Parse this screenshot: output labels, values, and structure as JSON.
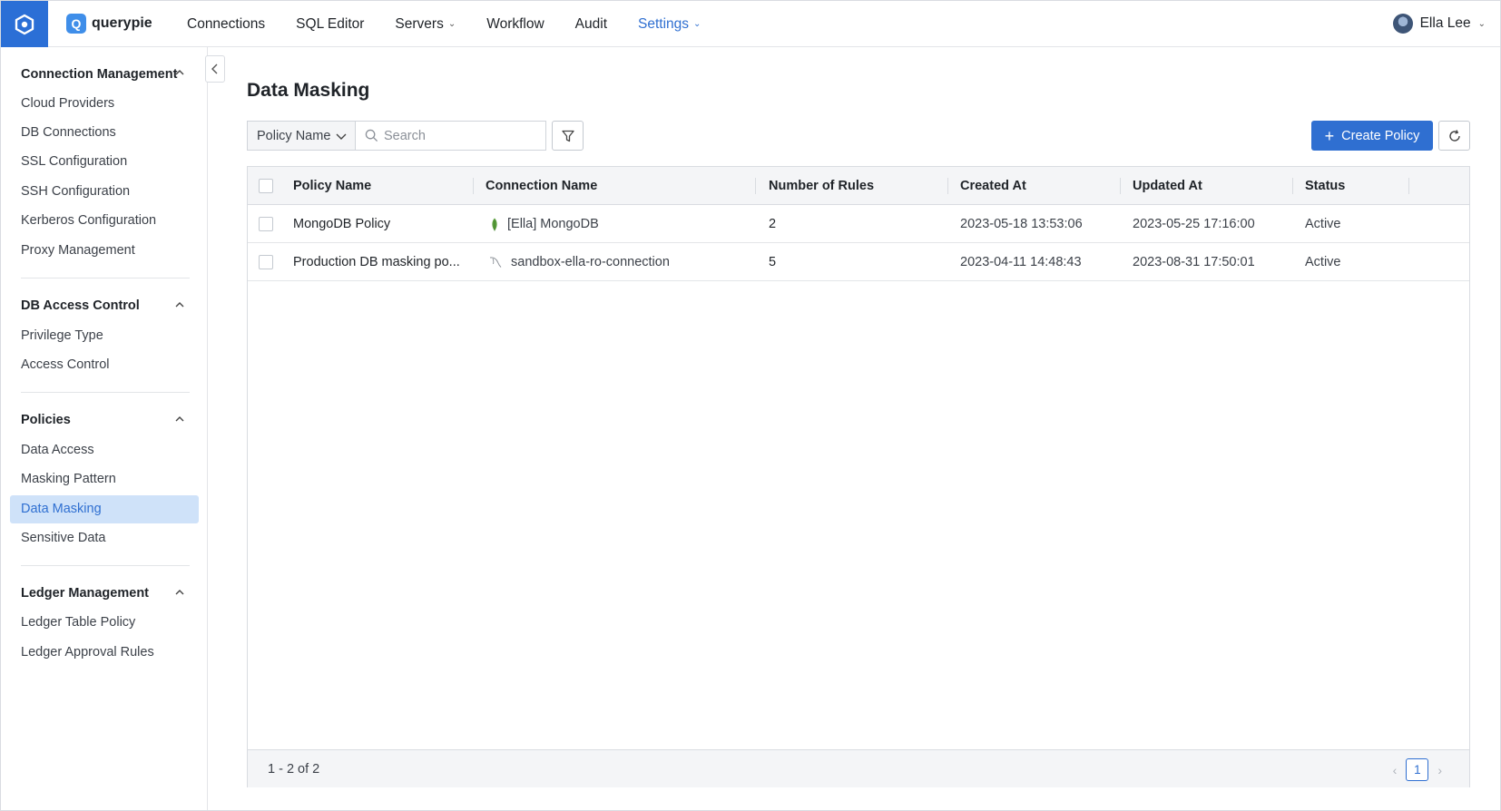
{
  "app": {
    "brand_glyph": "Q",
    "brand_name": "querypie",
    "accent_color": "#2f6fd1"
  },
  "nav": {
    "items": [
      {
        "label": "Connections",
        "icon": null
      },
      {
        "label": "SQL Editor",
        "icon": null
      },
      {
        "label": "Servers",
        "icon": "chevron-down-icon"
      },
      {
        "label": "Workflow",
        "icon": null
      },
      {
        "label": "Audit",
        "icon": null
      },
      {
        "label": "Settings",
        "icon": "chevron-down-icon",
        "active": true
      }
    ],
    "user_name": "Ella Lee"
  },
  "sidebar": {
    "sections": [
      {
        "title": "Connection Management",
        "items": [
          "Cloud Providers",
          "DB Connections",
          "SSL Configuration",
          "SSH Configuration",
          "Kerberos Configuration",
          "Proxy Management"
        ]
      },
      {
        "title": "DB Access Control",
        "items": [
          "Privilege Type",
          "Access Control"
        ]
      },
      {
        "title": "Policies",
        "items": [
          "Data Access",
          "Masking Pattern",
          "Data Masking",
          "Sensitive Data"
        ],
        "active_item": "Data Masking"
      },
      {
        "title": "Ledger Management",
        "items": [
          "Ledger Table Policy",
          "Ledger Approval Rules"
        ]
      }
    ]
  },
  "main": {
    "title": "Data Masking",
    "filter_field": "Policy Name",
    "search_placeholder": "Search",
    "create_label": "Create Policy",
    "table": {
      "columns": [
        "Policy Name",
        "Connection Name",
        "Number of Rules",
        "Created At",
        "Updated At",
        "Status"
      ],
      "rows": [
        {
          "policy_name": "MongoDB Policy",
          "connection_icon": "mongodb-leaf-icon",
          "connection_name": "[Ella] MongoDB",
          "rules": "2",
          "created_at": "2023-05-18 13:53:06",
          "updated_at": "2023-05-25 17:16:00",
          "status": "Active"
        },
        {
          "policy_name": "Production DB masking po...",
          "connection_icon": "mysql-dolphin-icon",
          "connection_name": "sandbox-ella-ro-connection",
          "rules": "5",
          "created_at": "2023-04-11 14:48:43",
          "updated_at": "2023-08-31 17:50:01",
          "status": "Active"
        }
      ]
    },
    "pagination": {
      "range_text": "1 - 2 of 2",
      "current_page": "1"
    }
  }
}
